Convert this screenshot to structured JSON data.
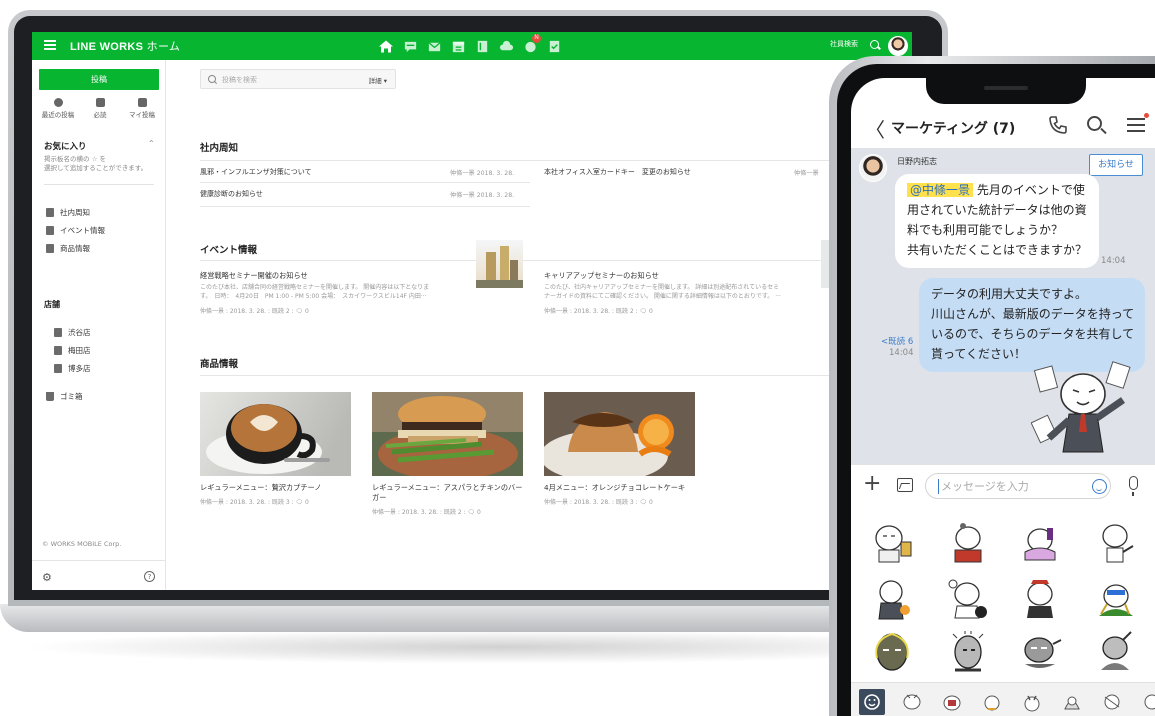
{
  "desktop": {
    "brand": {
      "name": "LINE WORKS",
      "page": "ホーム"
    },
    "topbar": {
      "icons": [
        "home-icon",
        "message-icon",
        "mail-icon",
        "calendar-icon",
        "address-book-icon",
        "drive-icon",
        "board-icon",
        "form-icon"
      ],
      "notification_badge": "N",
      "search_label": "社員検索"
    },
    "sidebar": {
      "post_button": "投稿",
      "quick_links": [
        {
          "label": "最近の投稿",
          "icon": "clock-icon"
        },
        {
          "label": "必読",
          "icon": "check-icon"
        },
        {
          "label": "マイ投稿",
          "icon": "my-icon"
        }
      ],
      "favorites": {
        "title": "お気に入り",
        "desc_line1": "掲示板名の横の ☆ を",
        "desc_line2": "選択して追加することができます。"
      },
      "boards": [
        "社内周知",
        "イベント情報",
        "商品情報"
      ],
      "store_title": "店舗",
      "stores": [
        "渋谷店",
        "梅田店",
        "博多店"
      ],
      "trash": "ゴミ箱",
      "copyright": "© WORKS MOBILE Corp."
    },
    "search": {
      "placeholder": "投稿を検索",
      "detail": "詳細 ▾"
    },
    "sections": {
      "notice": {
        "title": "社内周知",
        "items": [
          {
            "title": "風邪・インフルエンザ対策について",
            "meta": "仲條一景  2018. 3. 28."
          },
          {
            "title": "本社オフィス入室カードキー　変更のお知らせ",
            "meta": "仲條一景"
          },
          {
            "title": "健康診断のお知らせ",
            "meta": "仲條一景  2018. 3. 28."
          }
        ]
      },
      "events": {
        "title": "イベント情報",
        "items": [
          {
            "title": "経営戦略セミナー開催のお知らせ",
            "body1": "このたび本社、店舗合同の経営戦略セミナーを開催します。 開催内容は以下となりま",
            "body2": "す。　日時：　4月20日　PM 1:00 - PM 5:00 会場：　スカイワークスビル14F 内田···",
            "meta": "仲條一景 : 2018. 3. 28. : 既読 2 : 🗨 0"
          },
          {
            "title": "キャリアアップセミナーのお知らせ",
            "body1": "このたび、社内キャリアアップセミナーを開催します。 詳細は別途配布されているセミ",
            "body2": "ナーガイドの資料にてご確認ください。 開催に関する詳細情報は以下のとおりです。 ···",
            "meta": "仲條一景 : 2018. 3. 28. : 既読 2 : 🗨 0"
          }
        ]
      },
      "products": {
        "title": "商品情報",
        "items": [
          {
            "name": "レギュラーメニュー：贅沢カプチーノ",
            "meta": "仲條一景 : 2018. 3. 28. : 既読 3 : 🗨 0"
          },
          {
            "name": "レギュラーメニュー：アスパラとチキンのバーガー",
            "meta": "仲條一景 : 2018. 3. 28. : 既読 2 : 🗨 0"
          },
          {
            "name": "4月メニュー：オレンジチョコレートケーキ",
            "meta": "仲條一景 : 2018. 3. 28. : 既読 3 : 🗨 0"
          }
        ]
      }
    }
  },
  "phone": {
    "header": {
      "back": "〈",
      "title": "マーケティング (7)"
    },
    "messages": {
      "sender": "日野内拓志",
      "notice_button": "お知らせ",
      "incoming": {
        "mention": "@中條一景",
        "line1": " 先月のイベントで使",
        "line2": "用されていた統計データは他の資",
        "line3": "料でも利用可能でしょうか？",
        "line4": "共有いただくことはできますか？",
        "time": "14:04"
      },
      "outgoing": {
        "line1": "データの利用大丈夫ですよ。",
        "line2": "川山さんが、最新版のデータを持って",
        "line3": "いるので、そちらのデータを共有して",
        "line4": "貰ってください！",
        "read": "<既読 6",
        "time": "14:04"
      }
    },
    "input": {
      "placeholder": "メッセージを入力"
    }
  },
  "colors": {
    "brand_green": "#08b531",
    "bubble_out": "#c5dcf5",
    "chat_bg": "#dfe3e9",
    "mention_highlight": "#ffe14d"
  }
}
